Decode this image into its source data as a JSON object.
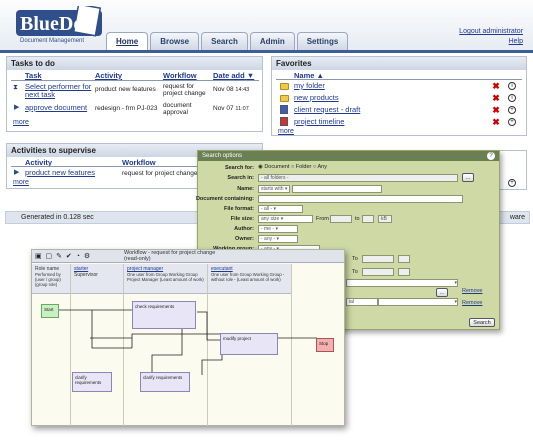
{
  "app": {
    "logo_text": "BlueDoc",
    "logo_sub": "Document Management",
    "tabs": [
      "Home",
      "Browse",
      "Search",
      "Admin",
      "Settings"
    ],
    "logout": "Logout administrator",
    "help": "Help"
  },
  "tasks": {
    "title": "Tasks to do",
    "headers": [
      "Task",
      "Activity",
      "Workflow",
      "Date add"
    ],
    "rows": [
      {
        "task": "Select performer for next task",
        "activity": "product new features",
        "workflow": "request for project change",
        "date": "Nov 08",
        "time": "14:43"
      },
      {
        "task": "approve document",
        "activity": "redesign - frm PJ-023",
        "workflow": "document approval",
        "date": "Nov 07",
        "time": "11:07"
      }
    ],
    "more": "more"
  },
  "supervise": {
    "title": "Activities to supervise",
    "headers": [
      "Activity",
      "Workflow"
    ],
    "rows": [
      {
        "activity": "product new features",
        "workflow": "request for project change"
      }
    ],
    "more": "more"
  },
  "favorites": {
    "title": "Favorites",
    "header": "Name",
    "items": [
      "my folder",
      "new products",
      "client request - draft",
      "project timeline"
    ],
    "more": "more"
  },
  "footer": {
    "generated": "Generated in 0.128 sec",
    "right_fragment": "ware"
  },
  "search": {
    "title": "Search options",
    "search_for_label": "Search for:",
    "search_for_options": [
      "Document",
      "Folder",
      "Any"
    ],
    "search_in_label": "Search in:",
    "search_in_value": "- all folders -",
    "browse_btn": "...",
    "name_label": "Name:",
    "name_mode": "starts with",
    "content_label": "Document containing:",
    "format_label": "File format:",
    "format_value": "- all -",
    "size_label": "File size:",
    "size_value": "any size",
    "from_label": "From",
    "to_label": "to",
    "size_unit": "kB",
    "author_label": "Author:",
    "author_value": "- me -",
    "owner_label": "Owner:",
    "owner_value": "- any -",
    "group_label": "Working group:",
    "group_value": "- any -",
    "to2_label": "To",
    "to3_label": "To",
    "ial_fragment": "ial",
    "remove1": "Remove",
    "remove2": "Remove",
    "search_btn": "Search",
    "help_icon": "?"
  },
  "workflow": {
    "title": "Workflow - request for project change",
    "subtitle": "(read-only)",
    "row_label": "Role name",
    "row_sub": "Performed by (user / group) (group role)",
    "lanes": [
      {
        "name": "starter",
        "desc": "Supervisor"
      },
      {
        "name": "project manager",
        "desc": "One user from Group Working Group Project Manager (Least amount of work)"
      },
      {
        "name": "executant",
        "desc": "One user from Group Working Group - without role - (Least amount of work)"
      }
    ],
    "nodes": [
      "Start",
      "check requirements",
      "modify project",
      "Stop",
      "clarify requirements",
      "clarify requirements"
    ]
  }
}
